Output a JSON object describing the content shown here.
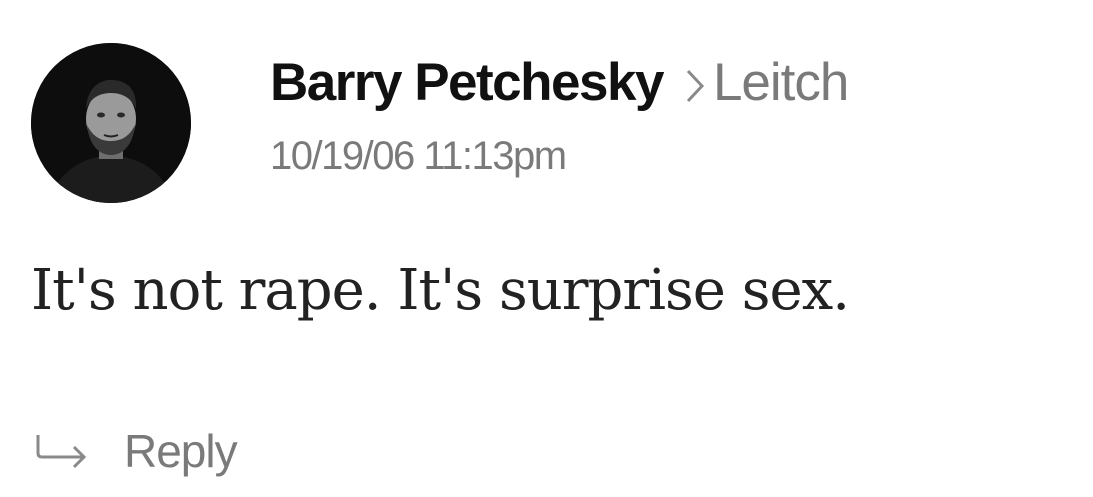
{
  "comment": {
    "author": "Barry Petchesky",
    "reply_to": "Leitch",
    "timestamp": "10/19/06 11:13pm",
    "body": "It's not rape. It's surprise sex.",
    "reply_label": "Reply"
  },
  "icons": {
    "avatar": "author-avatar",
    "chevron": "chevron-right-icon",
    "reply": "reply-arrow-icon"
  },
  "colors": {
    "author_text": "#111111",
    "muted_text": "#7a7a7a",
    "body_text": "#222222",
    "avatar_bg": "#0d0d0d"
  }
}
